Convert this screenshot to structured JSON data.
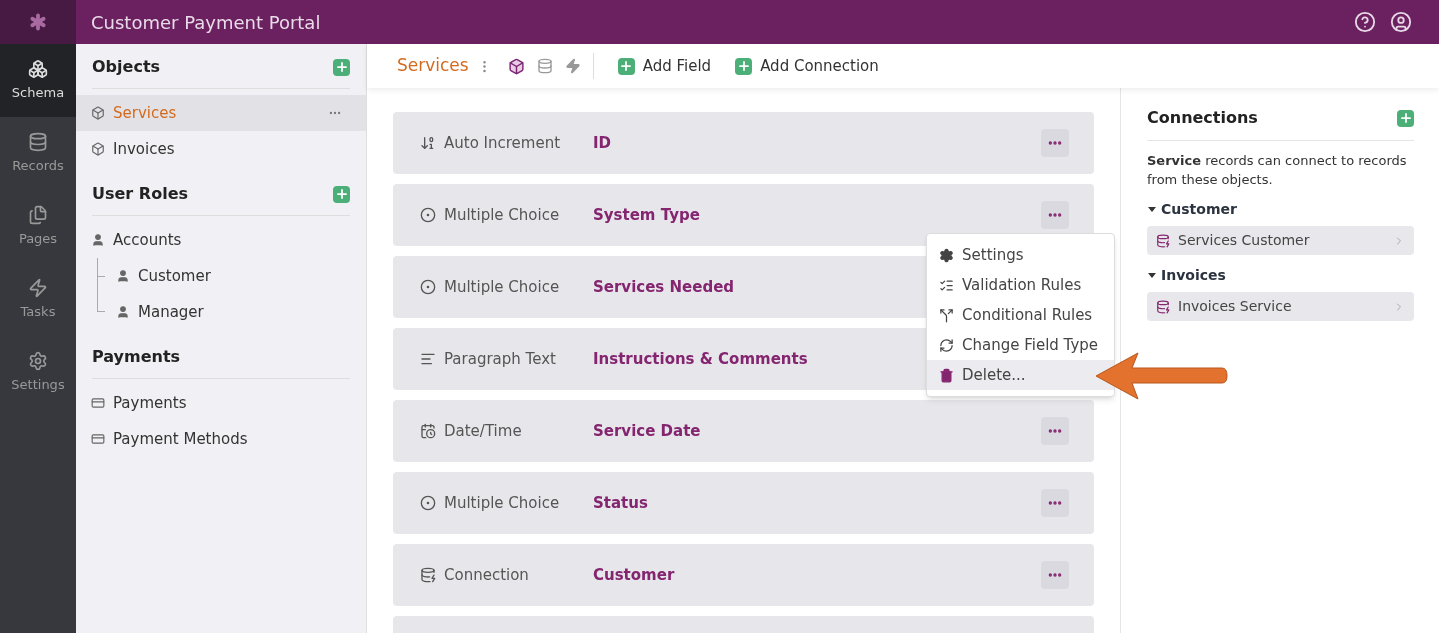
{
  "app": {
    "title": "Customer Payment Portal"
  },
  "nav": [
    {
      "label": "Schema",
      "kind": "schema",
      "selected": true
    },
    {
      "label": "Records",
      "kind": "records",
      "selected": false
    },
    {
      "label": "Pages",
      "kind": "pages",
      "selected": false
    },
    {
      "label": "Tasks",
      "kind": "tasks",
      "selected": false
    },
    {
      "label": "Settings",
      "kind": "settings",
      "selected": false
    }
  ],
  "sidebar": {
    "sections": [
      {
        "title": "Objects",
        "add": true,
        "items": [
          {
            "label": "Services",
            "kind": "object",
            "selected": true
          },
          {
            "label": "Invoices",
            "kind": "object",
            "selected": false
          }
        ]
      },
      {
        "title": "User Roles",
        "add": true,
        "items": [
          {
            "label": "Accounts",
            "kind": "user",
            "selected": false,
            "children": [
              {
                "label": "Customer",
                "kind": "user",
                "selected": false
              },
              {
                "label": "Manager",
                "kind": "user",
                "selected": false
              }
            ]
          }
        ]
      },
      {
        "title": "Payments",
        "add": false,
        "items": [
          {
            "label": "Payments",
            "kind": "card",
            "selected": false
          },
          {
            "label": "Payment Methods",
            "kind": "card",
            "selected": false
          }
        ]
      }
    ]
  },
  "toolbar": {
    "title": "Services",
    "buttons": [
      "Add Field",
      "Add Connection"
    ]
  },
  "fields": [
    {
      "type": "Auto Increment",
      "kind": "autoincrement",
      "name": "ID"
    },
    {
      "type": "Multiple Choice",
      "kind": "choice",
      "name": "System Type"
    },
    {
      "type": "Multiple Choice",
      "kind": "choice",
      "name": "Services Needed"
    },
    {
      "type": "Paragraph Text",
      "kind": "paragraph",
      "name": "Instructions & Comments"
    },
    {
      "type": "Date/Time",
      "kind": "datetime",
      "name": "Service Date"
    },
    {
      "type": "Multiple Choice",
      "kind": "choice",
      "name": "Status"
    },
    {
      "type": "Connection",
      "kind": "connection",
      "name": "Customer"
    },
    {
      "kind": "blank"
    }
  ],
  "menu": {
    "open": true,
    "items": [
      {
        "label": "Settings",
        "kind": "settings",
        "selected": false
      },
      {
        "label": "Validation Rules",
        "kind": "validation",
        "selected": false
      },
      {
        "label": "Conditional Rules",
        "kind": "conditional",
        "selected": false
      },
      {
        "label": "Change Field Type",
        "kind": "change",
        "selected": false
      },
      {
        "label": "Delete...",
        "kind": "delete",
        "selected": true
      }
    ]
  },
  "connections": {
    "title": "Connections",
    "description": "**Service** records can connect to records from these objects.",
    "groups": [
      {
        "title": "Customer",
        "items": [
          "Services Customer"
        ]
      },
      {
        "title": "Invoices",
        "items": [
          "Invoices Service"
        ]
      }
    ]
  }
}
